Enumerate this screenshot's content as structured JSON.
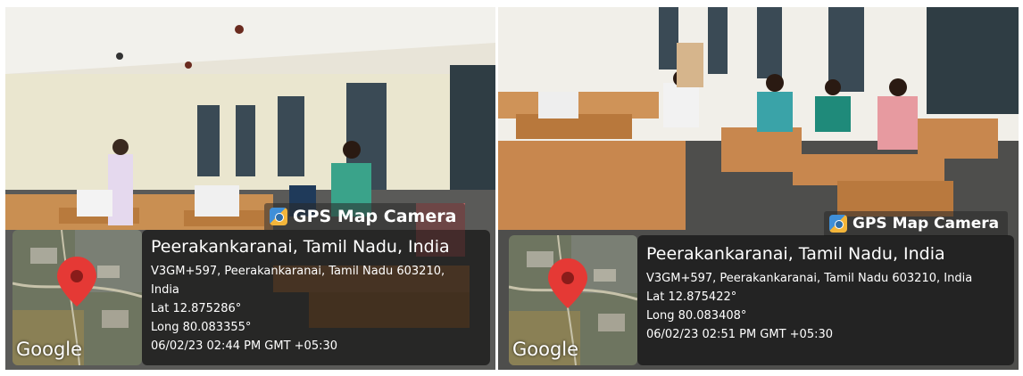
{
  "photos": [
    {
      "overlay_title": "GPS Map Camera",
      "map_brand": "Google",
      "location": "Peerakankaranai, Tamil Nadu, India",
      "address_line1": "V3GM+597, Peerakankaranai, Tamil Nadu 603210,",
      "address_line2": "India",
      "lat": "Lat 12.875286°",
      "long": "Long 80.083355°",
      "timestamp": "06/02/23 02:44 PM GMT +05:30"
    },
    {
      "overlay_title": "GPS Map Camera",
      "map_brand": "Google",
      "location": "Peerakankaranai, Tamil Nadu, India",
      "address_line1": "V3GM+597, Peerakankaranai, Tamil Nadu 603210, India",
      "lat": "Lat 12.875422°",
      "long": "Long 80.083408°",
      "timestamp": "06/02/23 02:51 PM GMT +05:30"
    }
  ],
  "colors": {
    "pin": "#e53935",
    "overlay": "#1e1e1e",
    "desk": "#c8874e"
  }
}
